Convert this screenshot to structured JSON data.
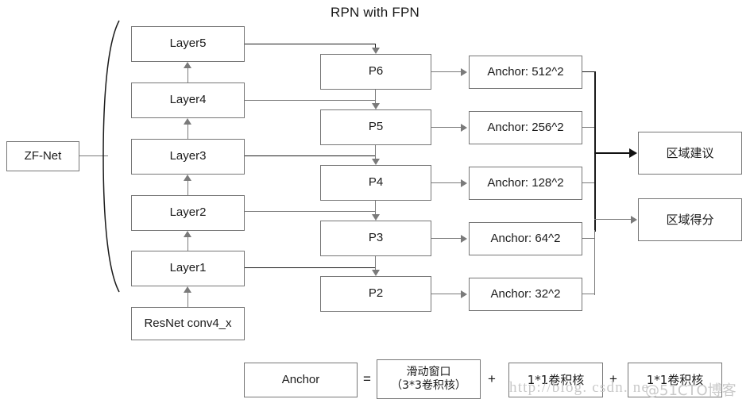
{
  "diagram": {
    "title": "RPN with FPN",
    "backbone": {
      "input_label": "ZF-Net",
      "base_label": "ResNet conv4_x",
      "layers": [
        {
          "label": "Layer5"
        },
        {
          "label": "Layer4"
        },
        {
          "label": "Layer3"
        },
        {
          "label": "Layer2"
        },
        {
          "label": "Layer1"
        }
      ]
    },
    "pyramid": {
      "levels": [
        {
          "label": "P6"
        },
        {
          "label": "P5"
        },
        {
          "label": "P4"
        },
        {
          "label": "P3"
        },
        {
          "label": "P2"
        }
      ]
    },
    "anchors": {
      "items": [
        {
          "label": "Anchor: 512^2"
        },
        {
          "label": "Anchor: 256^2"
        },
        {
          "label": "Anchor: 128^2"
        },
        {
          "label": "Anchor: 64^2"
        },
        {
          "label": "Anchor: 32^2"
        }
      ]
    },
    "outputs": [
      {
        "label": "区域建议"
      },
      {
        "label": "区域得分"
      }
    ],
    "formula": {
      "term_anchor": "Anchor",
      "equals": "=",
      "plus_1": "+",
      "plus_2": "+",
      "sliding_window_line1": "滑动窗口",
      "sliding_window_line2": "（3*3卷积核）",
      "conv_1x1_a": "1*1卷积核",
      "conv_1x1_b": "1*1卷积核"
    },
    "watermark": {
      "url": "http://blog. csdn. ne",
      "tag": "@51CTO博客"
    },
    "colors": {
      "box_border": "#767676",
      "line": "#7a7a7a",
      "line_dark": "#1b1b1b",
      "text": "#1a1a1a",
      "background": "#ffffff",
      "watermark": "#c9c9c9"
    }
  }
}
